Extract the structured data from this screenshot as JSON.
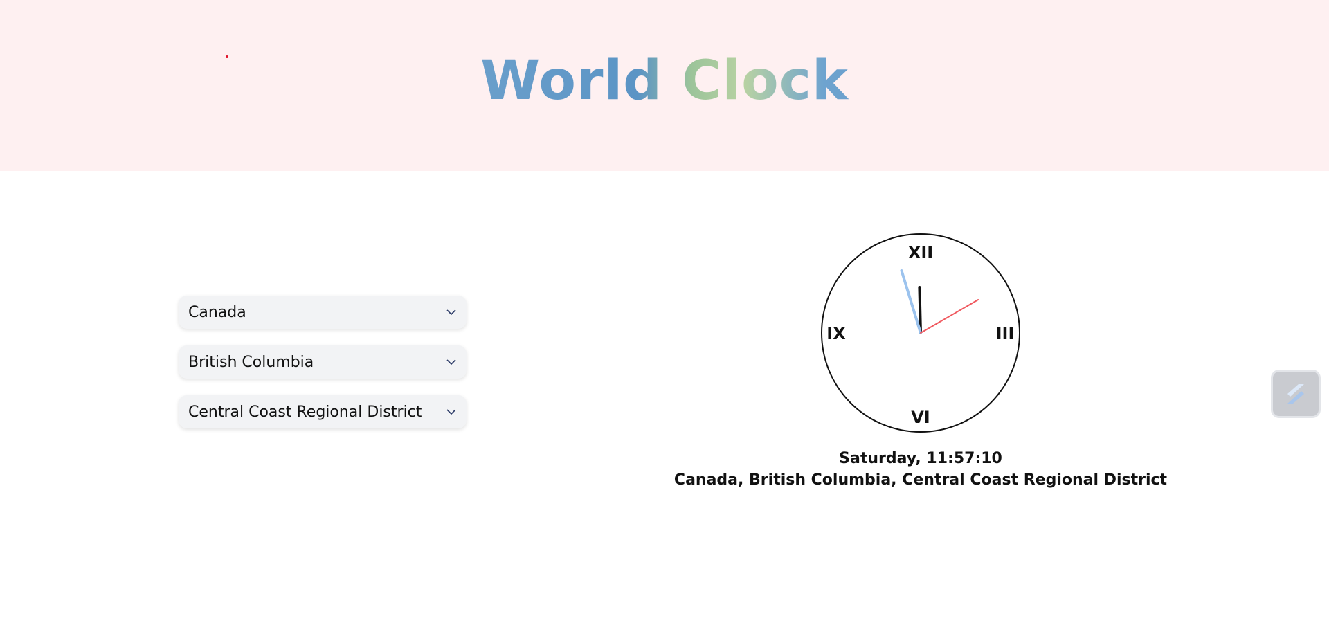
{
  "header": {
    "title": "World Clock",
    "background_color": "#fef0f1",
    "dot_color": "#e0142b"
  },
  "selectors": [
    {
      "label": "Canada",
      "icon": "chevron-down-icon"
    },
    {
      "label": "British Columbia",
      "icon": "chevron-down-icon"
    },
    {
      "label": "Central Coast Regional District",
      "icon": "chevron-down-icon"
    }
  ],
  "clock": {
    "numerals": {
      "top": "XII",
      "right": "III",
      "bottom": "VI",
      "left": "IX"
    },
    "time": {
      "hours": 11,
      "minutes": 57,
      "seconds": 10
    },
    "hand_colors": {
      "hour": "#111111",
      "minute": "#9cc3ee",
      "second": "#f0595f"
    },
    "day_time": "Saturday, 11:57:10",
    "location": "Canada, British Columbia, Central Coast Regional District"
  },
  "side_widget": {
    "icon": "extension-icon"
  }
}
